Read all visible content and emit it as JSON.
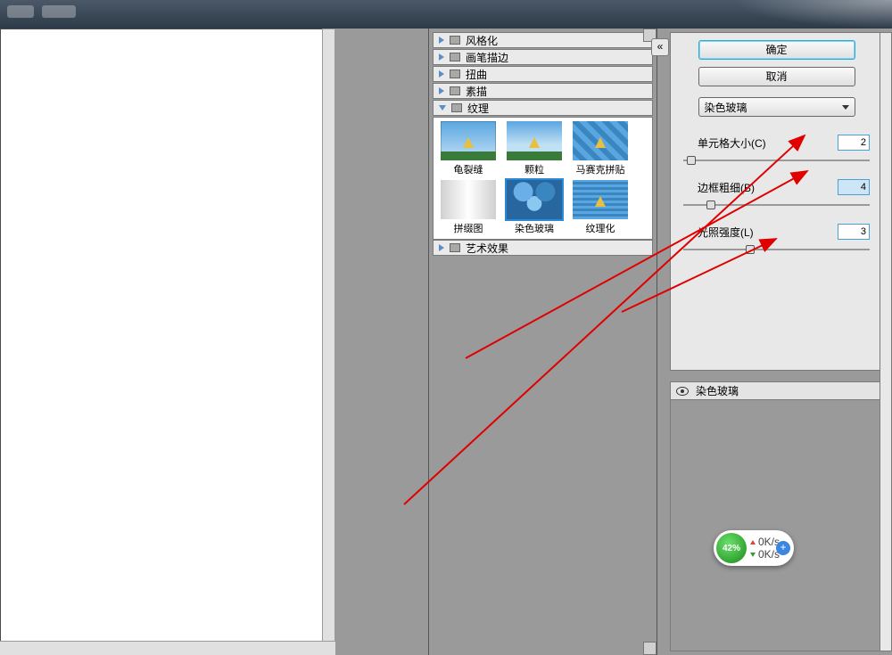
{
  "buttons": {
    "ok": "确定",
    "cancel": "取消"
  },
  "dropdown": {
    "selected": "染色玻璃"
  },
  "categories": [
    {
      "label": "风格化"
    },
    {
      "label": "画笔描边"
    },
    {
      "label": "扭曲"
    },
    {
      "label": "素描"
    },
    {
      "label": "纹理"
    },
    {
      "label": "艺术效果"
    }
  ],
  "thumbs": [
    {
      "label": "龟裂缝"
    },
    {
      "label": "颗粒"
    },
    {
      "label": "马赛克拼贴"
    },
    {
      "label": "拼缀图"
    },
    {
      "label": "染色玻璃"
    },
    {
      "label": "纹理化"
    }
  ],
  "params": {
    "cell": {
      "label": "单元格大小(C)",
      "value": "2"
    },
    "border": {
      "label": "边框粗细(B)",
      "value": "4"
    },
    "light": {
      "label": "光照强度(L)",
      "value": "3"
    }
  },
  "preview": {
    "title": "染色玻璃"
  },
  "widget": {
    "pct": "42%",
    "up": "0K/s",
    "dn": "0K/s"
  }
}
